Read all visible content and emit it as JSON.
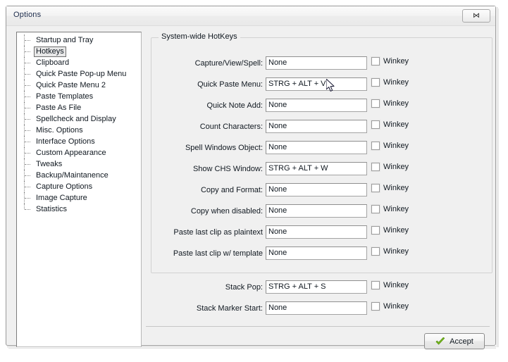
{
  "window": {
    "title": "Options",
    "close_glyph": "⋈"
  },
  "sidebar": {
    "items": [
      {
        "label": "Startup and Tray",
        "selected": false
      },
      {
        "label": "Hotkeys",
        "selected": true
      },
      {
        "label": "Clipboard",
        "selected": false
      },
      {
        "label": "Quick Paste Pop-up Menu",
        "selected": false
      },
      {
        "label": "Quick Paste Menu 2",
        "selected": false
      },
      {
        "label": "Paste Templates",
        "selected": false
      },
      {
        "label": "Paste As File",
        "selected": false
      },
      {
        "label": "Spellcheck and Display",
        "selected": false
      },
      {
        "label": "Misc. Options",
        "selected": false
      },
      {
        "label": "Interface Options",
        "selected": false
      },
      {
        "label": "Custom Appearance",
        "selected": false
      },
      {
        "label": "Tweaks",
        "selected": false
      },
      {
        "label": "Backup/Maintanence",
        "selected": false
      },
      {
        "label": "Capture Options",
        "selected": false
      },
      {
        "label": "Image Capture",
        "selected": false
      },
      {
        "label": "Statistics",
        "selected": false
      }
    ]
  },
  "main": {
    "group_title": "System-wide HotKeys",
    "checkbox_label": "Winkey",
    "rows": [
      {
        "label": "Capture/View/Spell:",
        "value": "None",
        "winkey": false,
        "gap_before": false
      },
      {
        "label": "Quick Paste Menu:",
        "value": "STRG + ALT + V",
        "winkey": false,
        "gap_before": false
      },
      {
        "label": "Quick Note Add:",
        "value": "None",
        "winkey": false,
        "gap_before": false
      },
      {
        "label": "Count Characters:",
        "value": "None",
        "winkey": false,
        "gap_before": false
      },
      {
        "label": "Spell Windows Object:",
        "value": "None",
        "winkey": false,
        "gap_before": false
      },
      {
        "label": "Show CHS Window:",
        "value": "STRG + ALT + W",
        "winkey": false,
        "gap_before": false
      },
      {
        "label": "Copy and Format:",
        "value": "None",
        "winkey": false,
        "gap_before": false
      },
      {
        "label": "Copy when disabled:",
        "value": "None",
        "winkey": false,
        "gap_before": false
      },
      {
        "label": "Paste last clip as plaintext",
        "value": "None",
        "winkey": false,
        "gap_before": false
      },
      {
        "label": "Paste last clip w/ template",
        "value": "None",
        "winkey": false,
        "gap_before": false
      },
      {
        "label": "Stack Pop:",
        "value": "STRG + ALT + S",
        "winkey": false,
        "gap_before": true
      },
      {
        "label": "Stack Marker Start:",
        "value": "None",
        "winkey": false,
        "gap_before": false
      }
    ]
  },
  "footer": {
    "accept_label": "Accept"
  },
  "colors": {
    "accent_green": "#7cc01f",
    "dialog_bg": "#f0f0f0",
    "field_bg": "#ffffff",
    "text": "#101820",
    "title_text": "#1b2a4a"
  }
}
